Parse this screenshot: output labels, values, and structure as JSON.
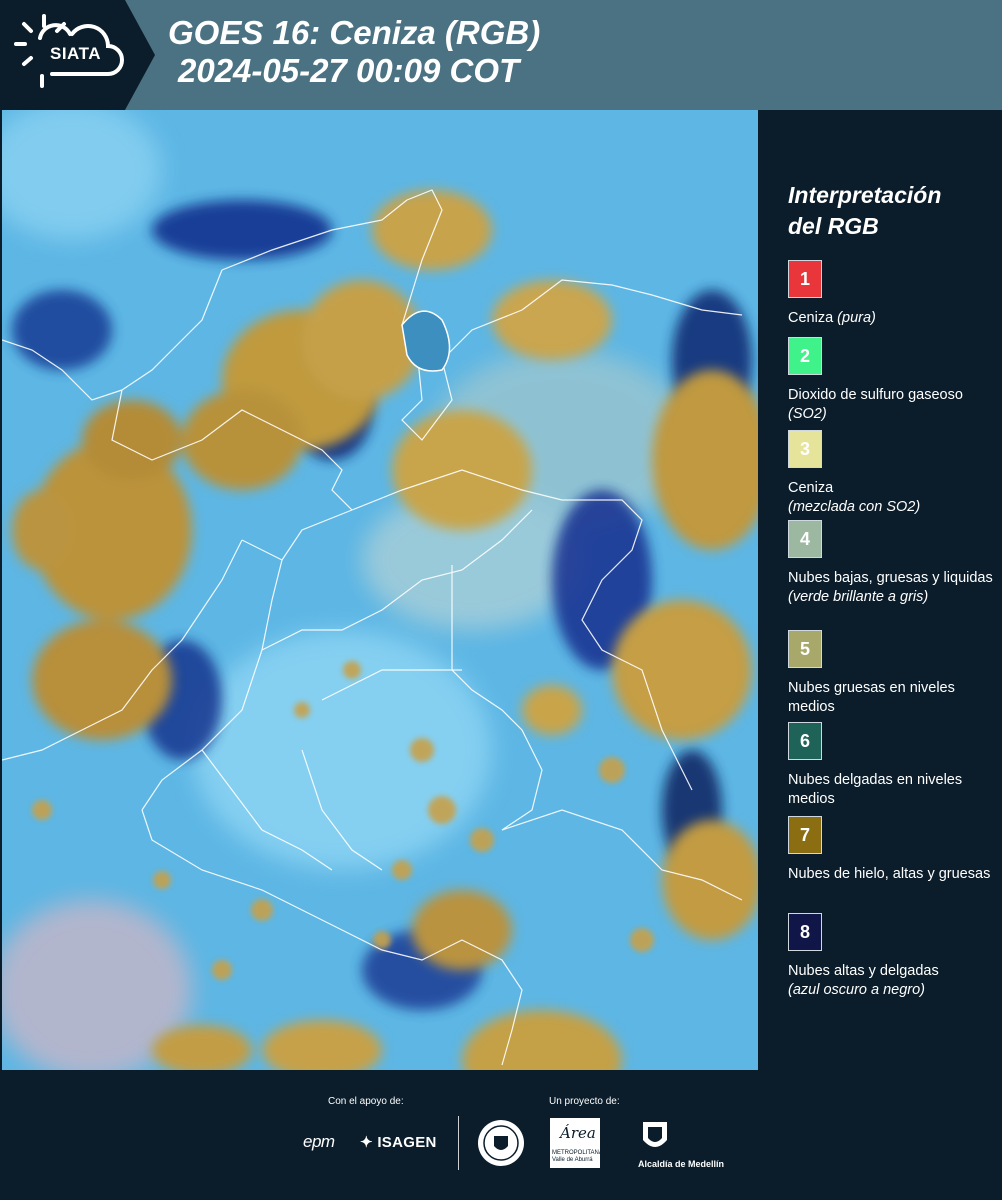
{
  "header": {
    "logo_text": "SIATA",
    "title_line1": "GOES 16: Ceniza (RGB)",
    "title_line2": "2024-05-27 00:09 COT"
  },
  "legend": {
    "title_line1": "Interpretación",
    "title_line2": "del RGB",
    "items": [
      {
        "number": "1",
        "color": "#e8363a",
        "label": "Ceniza",
        "note": "(pura)"
      },
      {
        "number": "2",
        "color": "#3ff28a",
        "label": "Dioxido de sulfuro gaseoso",
        "note": "(SO2)"
      },
      {
        "number": "3",
        "color": "#e6e49a",
        "label": "Ceniza",
        "note": "(mezclada con SO2)"
      },
      {
        "number": "4",
        "color": "#9cb8a0",
        "label": "Nubes bajas, gruesas y liquidas",
        "note": "(verde brillante a gris)"
      },
      {
        "number": "5",
        "color": "#a8a86a",
        "label": "Nubes gruesas en niveles medios",
        "note": ""
      },
      {
        "number": "6",
        "color": "#1f6358",
        "label": "Nubes delgadas en niveles medios",
        "note": ""
      },
      {
        "number": "7",
        "color": "#8c6e12",
        "label": "Nubes de hielo, altas y gruesas",
        "note": ""
      },
      {
        "number": "8",
        "color": "#101648",
        "label": "Nubes altas y delgadas",
        "note": "(azul oscuro a negro)"
      }
    ]
  },
  "footer": {
    "support_label": "Con el apoyo de:",
    "project_label": "Un proyecto de:",
    "sponsor1": "epm",
    "sponsor2": "ISAGEN",
    "area_word": "Área",
    "area_sub": "METROPOLITANA Valle de Aburrá",
    "medellin": "Alcaldía de Medellín"
  },
  "colors": {
    "header_bg": "#4b7282",
    "dark_bg": "#0b1d2a",
    "cloud_thick": "#c49a3a",
    "sky_blue": "#56aee0",
    "deep_blue": "#0f2a8a"
  }
}
